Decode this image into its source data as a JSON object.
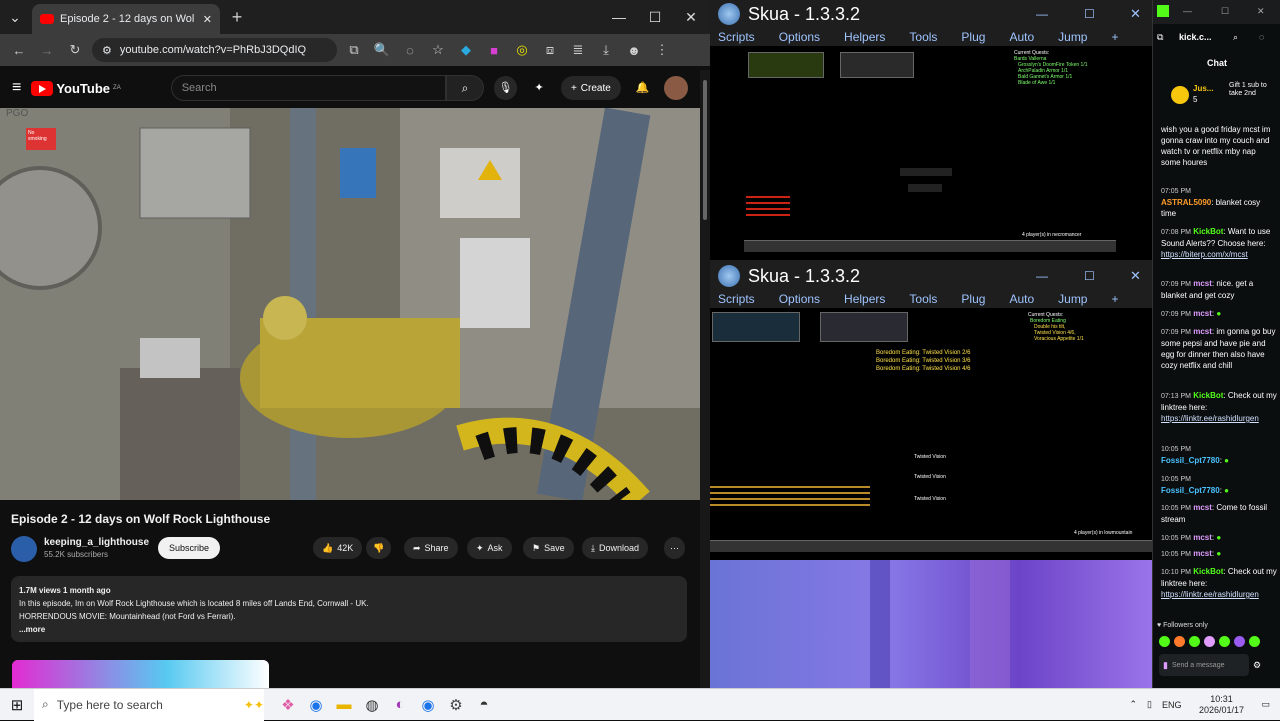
{
  "chrome": {
    "tab_title": "Episode 2 - 12 days on Wol",
    "new_tab": "+",
    "url": "youtube.com/watch?v=PhRbJ3DQdIQ"
  },
  "youtube": {
    "logo": "YouTube",
    "country": "ZA",
    "search_placeholder": "Search",
    "create_label": "Create",
    "video_title": "Episode 2 - 12 days on Wolf Rock Lighthouse",
    "channel_name": "keeping_a_lighthouse",
    "subscribers": "55.2K subscribers",
    "subscribe_label": "Subscribe",
    "like_count": "42K",
    "share_label": "Share",
    "ask_label": "Ask",
    "save_label": "Save",
    "download_label": "Download",
    "desc_stats": "1.7M views  1 month ago",
    "desc_line1": "In this episode, Im on Wolf Rock Lighthouse which is located 8 miles off Lands End, Cornwall - UK.",
    "desc_line2": "HORRENDOUS MOVIE: Mountainhead (not Ford vs Ferrari).",
    "desc_more": "...more",
    "sign_text": "No smoking",
    "sign_code": "PGO"
  },
  "skua1": {
    "title": "Skua - 1.3.3.2",
    "menu": [
      "Scripts",
      "Options",
      "Helpers",
      "Tools",
      "Plug",
      "Auto",
      "Jump",
      "+"
    ],
    "quests_title": "Current Quests:",
    "quests": [
      "Bards Vallerna",
      "Grosslyn's DoomFire Token 1/1",
      "ArchPaladin Armor 1/1",
      "Bald Gannet's Armor 1/1",
      "Blade of Awe 1/1"
    ],
    "players": "4 player(s) in necromancer"
  },
  "skua2": {
    "title": "Skua - 1.3.3.2",
    "menu": [
      "Scripts",
      "Options",
      "Helpers",
      "Tools",
      "Plug",
      "Auto",
      "Jump",
      "+"
    ],
    "quests_title": "Current Quests:",
    "quests": [
      "Boredom Eating",
      "Double his tilt,",
      "Twisted Vision 4/6,",
      "Voracious Appetite 1/1"
    ],
    "boredom": [
      "Boredom Eating: Twisted Vision 2/6",
      "Boredom Eating: Twisted Vision 3/6",
      "Boredom Eating: Twisted Vision 4/6"
    ],
    "tv_label": "Twisted Vision",
    "players": "4 player(s) in lowmountain"
  },
  "kick": {
    "domain": "kick.c...",
    "chat_label": "Chat",
    "pinned_user": "Jus...",
    "pinned_count": "5",
    "gift": "Gift 1 sub to take 2nd",
    "messages": [
      {
        "time": "",
        "name": "",
        "text": "wish you a good friday mcst im gonna craw into my couch and watch tv or netflix mby nap some houres"
      },
      {
        "time": "07:05 PM",
        "name": "ASTRAL5090",
        "text": "blanket cosy time"
      },
      {
        "time": "07:08 PM",
        "name": "KickBot",
        "text": "Want to use Sound Alerts?? Choose here: ",
        "link": "https://biterp.com/x/mcst"
      },
      {
        "time": "07:09 PM",
        "name": "mcst",
        "text": "nice. get a blanket and get cozy"
      },
      {
        "time": "07:09 PM",
        "name": "mcst",
        "text": ""
      },
      {
        "time": "07:09 PM",
        "name": "mcst",
        "text": "im gonna go buy some pepsi and have pie and egg for dinner then also have cozy netflix and chill"
      },
      {
        "time": "07:13 PM",
        "name": "KickBot",
        "text": "Check out my linktree here: ",
        "link": "https://linktr.ee/rashidlurgen"
      },
      {
        "time": "10:05 PM",
        "name": "Fossil_Cpt7780",
        "text": ""
      },
      {
        "time": "10:05 PM",
        "name": "Fossil_Cpt7780",
        "text": ""
      },
      {
        "time": "10:05 PM",
        "name": "mcst",
        "text": "Come to fossil stream"
      },
      {
        "time": "10:05 PM",
        "name": "mcst",
        "text": ""
      },
      {
        "time": "10:05 PM",
        "name": "mcst",
        "text": ""
      },
      {
        "time": "10:10 PM",
        "name": "KickBot",
        "text": "Check out my linktree here: ",
        "link": "https://linktr.ee/rashidlurgen"
      }
    ],
    "followers_only": "Followers only",
    "send_placeholder": "Send a message"
  },
  "taskbar": {
    "search_placeholder": "Type here to search",
    "lang": "ENG",
    "time": "10:31",
    "date": "2026/01/17"
  }
}
